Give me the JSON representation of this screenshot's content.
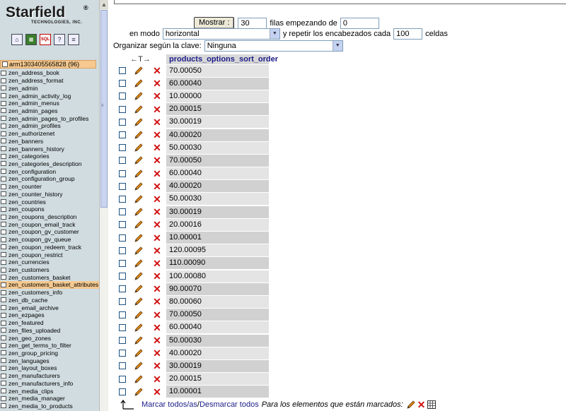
{
  "brand": {
    "name": "Starfield",
    "reg": "®",
    "tagline": "TECHNOLOGIES, INC."
  },
  "database": {
    "label": "arm1303405565828 (96)"
  },
  "tables": [
    "zen_address_book",
    "zen_address_format",
    "zen_admin",
    "zen_admin_activity_log",
    "zen_admin_menus",
    "zen_admin_pages",
    "zen_admin_pages_to_profiles",
    "zen_admin_profiles",
    "zen_authorizenet",
    "zen_banners",
    "zen_banners_history",
    "zen_categories",
    "zen_categories_description",
    "zen_configuration",
    "zen_configuration_group",
    "zen_counter",
    "zen_counter_history",
    "zen_countries",
    "zen_coupons",
    "zen_coupons_description",
    "zen_coupon_email_track",
    "zen_coupon_gv_customer",
    "zen_coupon_gv_queue",
    "zen_coupon_redeem_track",
    "zen_coupon_restrict",
    "zen_currencies",
    "zen_customers",
    "zen_customers_basket",
    "zen_customers_basket_attributes",
    "zen_customers_info",
    "zen_db_cache",
    "zen_email_archive",
    "zen_ezpages",
    "zen_featured",
    "zen_files_uploaded",
    "zen_geo_zones",
    "zen_get_terms_to_filter",
    "zen_group_pricing",
    "zen_languages",
    "zen_layout_boxes",
    "zen_manufacturers",
    "zen_manufacturers_info",
    "zen_media_clips",
    "zen_media_manager",
    "zen_media_to_products"
  ],
  "selected_table": "zen_customers_basket_attributes",
  "controls": {
    "show_button": "Mostrar :",
    "rows_count": "30",
    "rows_label": "filas empezando de",
    "start_value": "0",
    "mode_label": "en modo",
    "mode_value": "horizontal",
    "repeat_label": "y repetir los encabezados cada",
    "repeat_value": "100",
    "cells_label": "celdas",
    "sort_label": "Organizar según la clave:",
    "sort_value": "Ninguna"
  },
  "results": {
    "arrows": "←T→",
    "column": "products_options_sort_order",
    "rows": [
      "70.00050",
      "60.00040",
      "10.00000",
      "20.00015",
      "30.00019",
      "40.00020",
      "50.00030",
      "70.00050",
      "60.00040",
      "40.00020",
      "50.00030",
      "30.00019",
      "20.00016",
      "10.00001",
      "120.00095",
      "110.00090",
      "100.00080",
      "90.00070",
      "80.00060",
      "70.00050",
      "60.00040",
      "50.00030",
      "40.00020",
      "30.00019",
      "20.00015",
      "10.00001"
    ]
  },
  "footer": {
    "check_all": "Marcar todos/as",
    "separator": " / ",
    "uncheck_all": "Desmarcar todos",
    "marked_note": "Para los elementos que están marcados:"
  },
  "colors": {
    "selected_row": "#f5c98f",
    "header_text": "#1d1d8a",
    "delete": "#d01010"
  }
}
